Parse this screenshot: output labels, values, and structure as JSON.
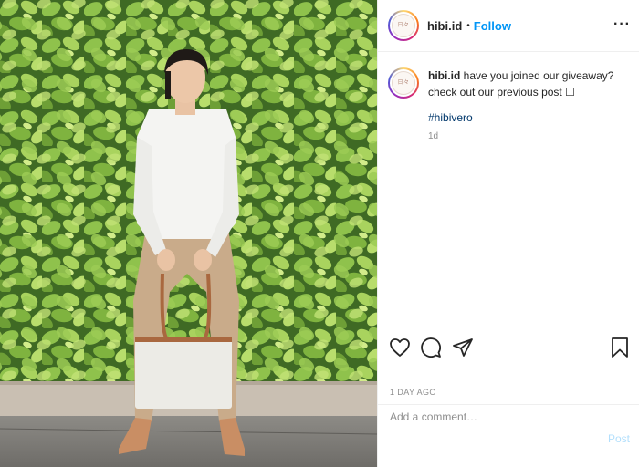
{
  "post": {
    "author": {
      "username": "hibi.id",
      "avatar_text": "日々"
    },
    "header": {
      "separator": "•",
      "follow_label": "Follow",
      "more_label": "···"
    },
    "caption": {
      "username": "hibi.id",
      "text": "have you joined our giveaway? check out our previous post",
      "emoji": "☐",
      "hashtag": "#hibivero",
      "time": "1d"
    },
    "actions": {
      "like_icon": "heart-icon",
      "comment_icon": "comment-icon",
      "share_icon": "share-icon",
      "save_icon": "bookmark-icon"
    },
    "date_label": "1 DAY AGO",
    "comment": {
      "placeholder": "Add a comment…",
      "post_label": "Post"
    }
  },
  "colors": {
    "link": "#0095f6",
    "hashtag": "#00376b",
    "muted": "#8e8e8e",
    "post_disabled": "#b2dffc",
    "foliage": "#5d8a3a"
  }
}
